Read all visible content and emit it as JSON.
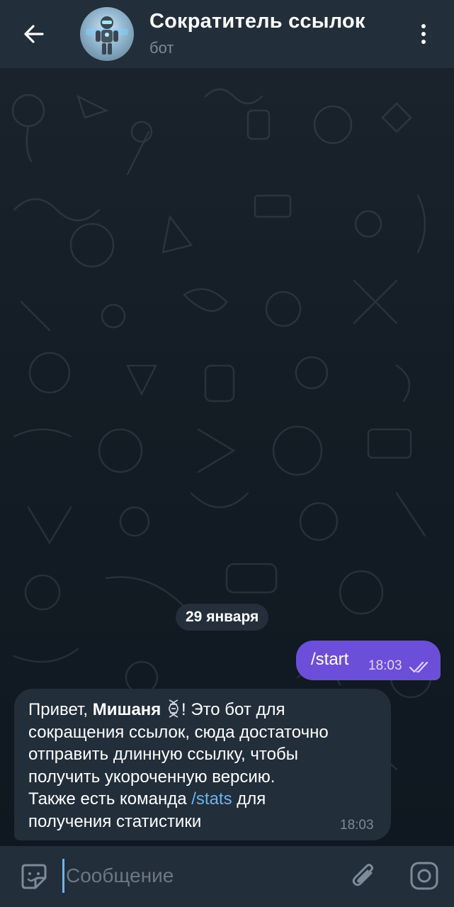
{
  "header": {
    "title": "Сократитель ссылок",
    "subtitle": "бот",
    "back_icon": "arrow-left-icon",
    "menu_icon": "more-vertical-icon"
  },
  "chat": {
    "date_divider": "29 января",
    "outgoing": {
      "text": "/start",
      "time": "18:03",
      "status_icon": "double-check-icon"
    },
    "incoming": {
      "greeting": "Привет, ",
      "name": "Мишаня",
      "name_icon": "dna-icon",
      "line1_rest": "! Это бот для",
      "line2": "сокращения ссылок, сюда достаточно",
      "line3": "отправить длинную ссылку, чтобы",
      "line4": "получить укороченную версию.",
      "line5_pre": "Также есть команда ",
      "command": "/stats",
      "line5_post": " для",
      "line6": "получения статистики",
      "time": "18:03"
    }
  },
  "input_bar": {
    "placeholder": "Сообщение",
    "value": "",
    "left_icon": "emoji-sticker-icon",
    "attach_icon": "paperclip-icon",
    "camera_icon": "camera-icon"
  },
  "colors": {
    "header_bg": "#222e3a",
    "chat_bg": "#141c25",
    "outgoing_bubble": "#6b4fd8",
    "incoming_bubble": "#222e3a",
    "link": "#6db3f2",
    "secondary_text": "#7d8b99"
  }
}
